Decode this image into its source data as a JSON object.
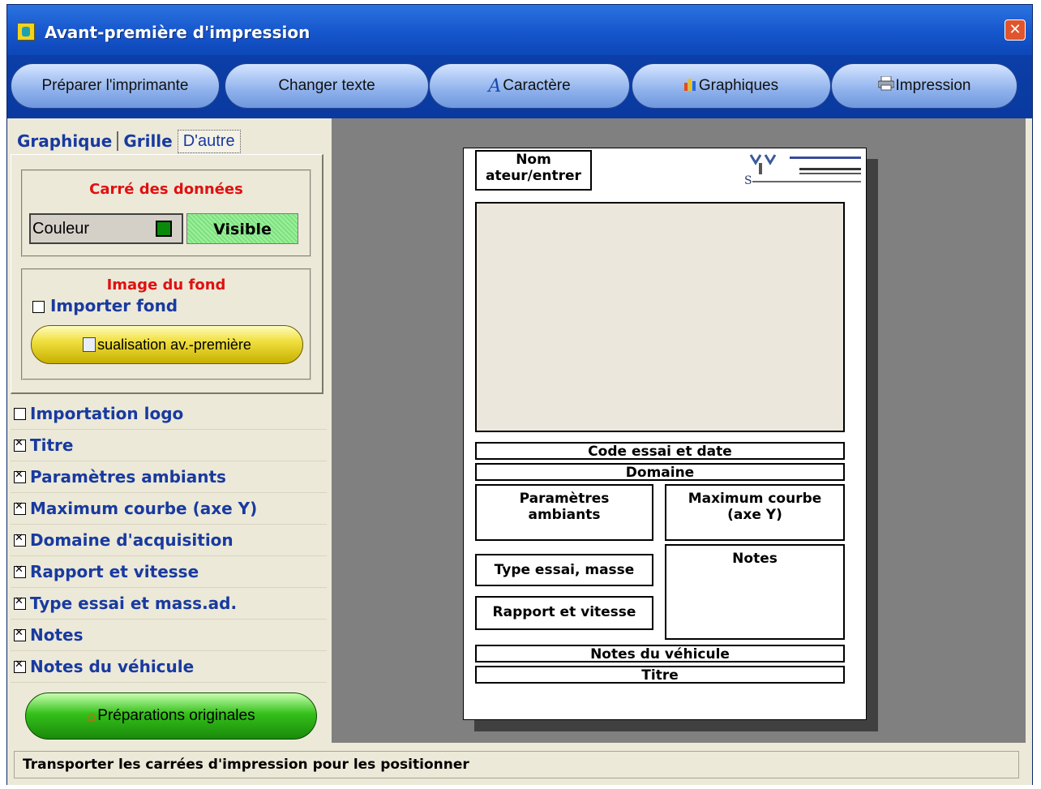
{
  "window": {
    "title": "Avant-première d'impression"
  },
  "toolbar": {
    "prepare_printer": "Préparer l'imprimante",
    "change_text": "Changer texte",
    "character": "Caractère",
    "graphics": "Graphiques",
    "print": "Impression"
  },
  "tabs": {
    "graphique": "Graphique",
    "grille": "Grille",
    "autre": "D'autre"
  },
  "data_square": {
    "title": "Carré des données",
    "color_label": "Couleur",
    "color": "#0a8a0a",
    "visible_label": "Visible"
  },
  "background_image": {
    "title": "Image du fond",
    "import_label": "Importer fond",
    "preview_button": "sualisation av.-première"
  },
  "checklist": [
    {
      "label": "Importation logo",
      "checked": false
    },
    {
      "label": "Titre",
      "checked": true
    },
    {
      "label": "Paramètres ambiants",
      "checked": true
    },
    {
      "label": "Maximum courbe (axe Y)",
      "checked": true
    },
    {
      "label": "Domaine d'acquisition",
      "checked": true
    },
    {
      "label": "Rapport et vitesse",
      "checked": true
    },
    {
      "label": "Type essai et mass.ad.",
      "checked": true
    },
    {
      "label": "Notes",
      "checked": true
    },
    {
      "label": "Notes du véhicule",
      "checked": true
    }
  ],
  "original_settings_button": "Préparations originales",
  "preview": {
    "name_box": "Nom\nateur/entrer",
    "code_box": "Code essai et date",
    "domain_box": "Domaine",
    "ambient_box": "Paramètres\nambiants",
    "max_curve_box": "Maximum courbe\n(axe Y)",
    "test_type_box": "Type essai, masse",
    "notes_box": "Notes",
    "ratio_speed_box": "Rapport et vitesse",
    "vehicle_notes_box": "Notes du véhicule",
    "title_box": "Titre"
  },
  "status": "Transporter les carrées d'impression pour les positionner"
}
